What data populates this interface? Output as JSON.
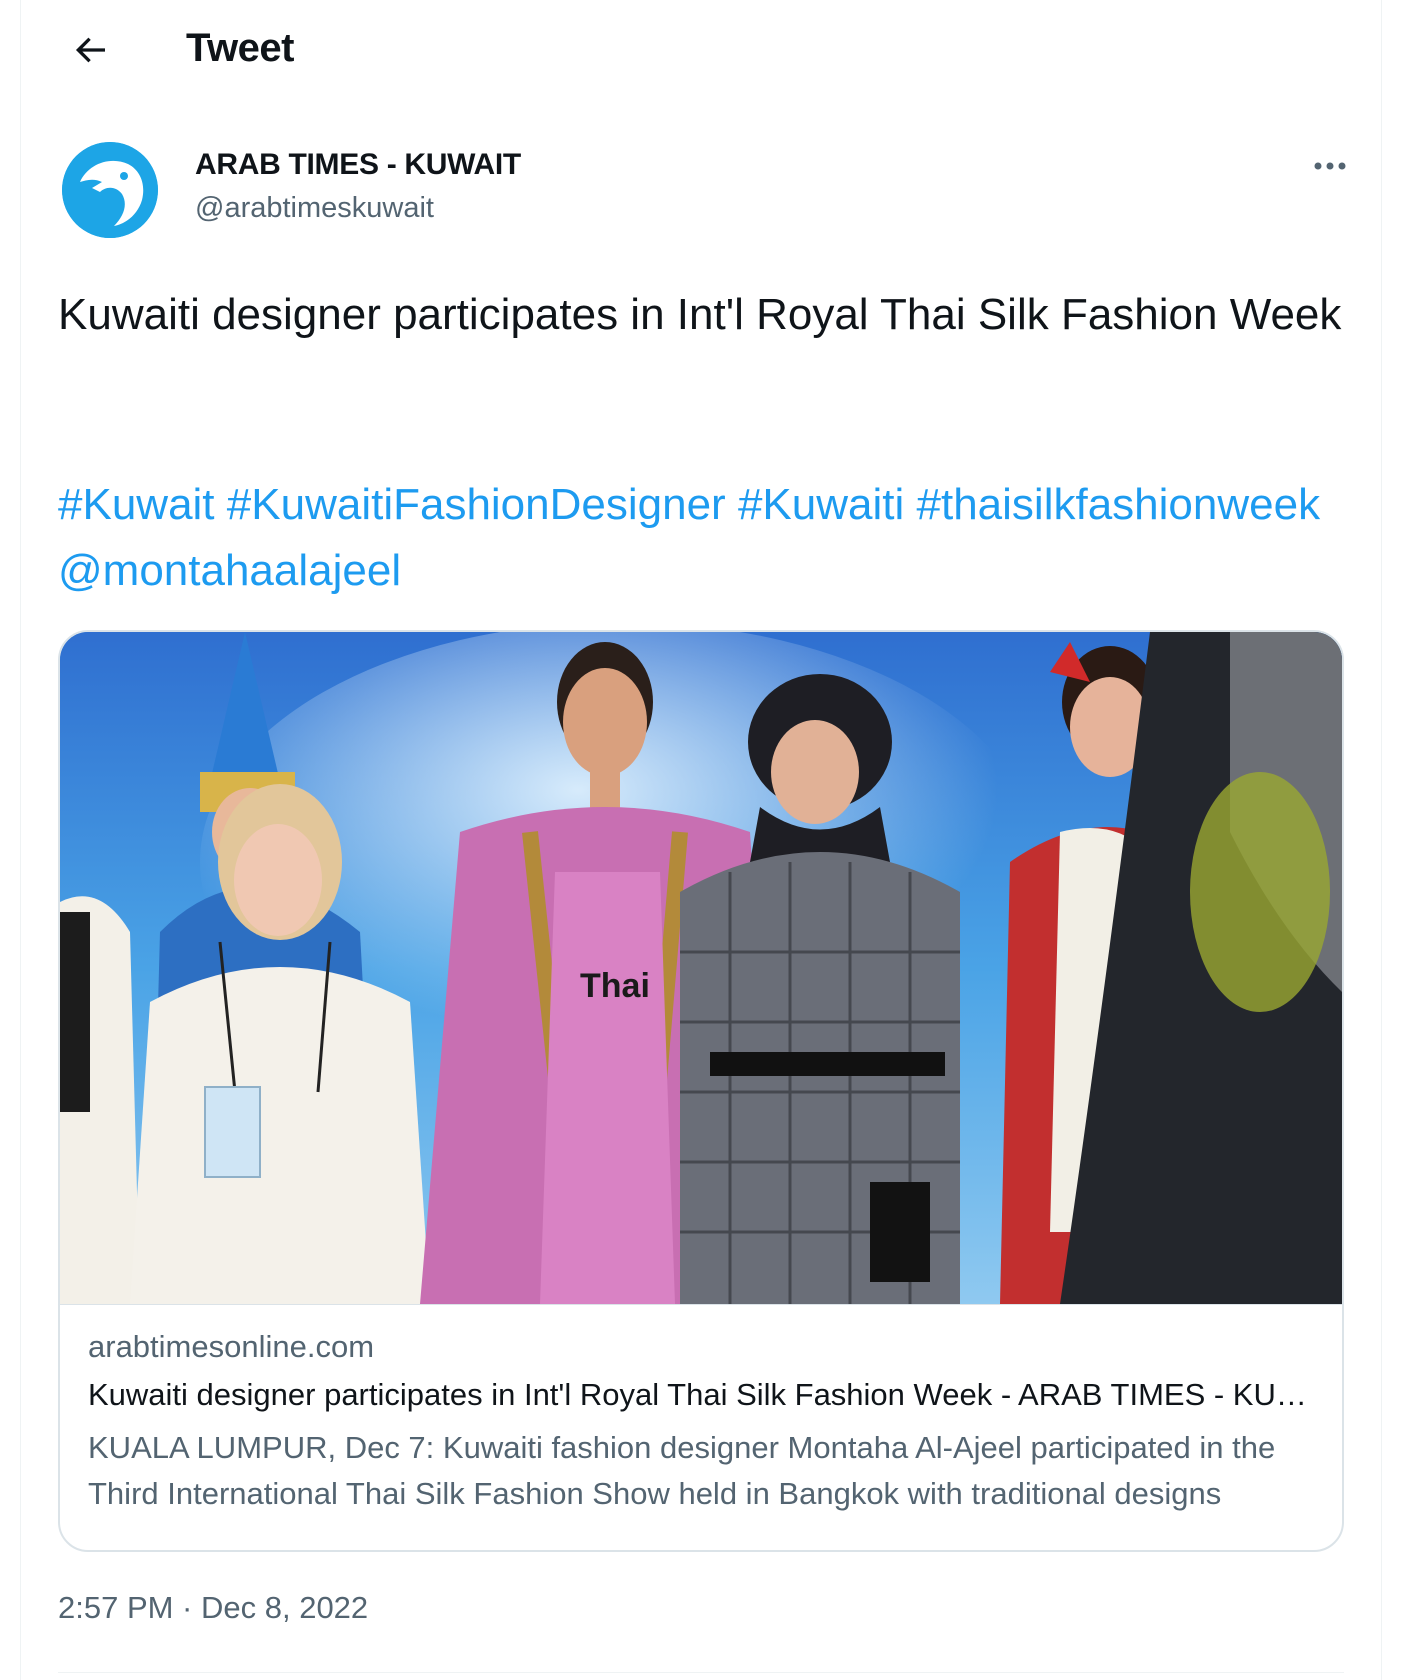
{
  "header": {
    "back_icon": "arrow-left-icon",
    "title": "Tweet"
  },
  "author": {
    "name": "ARAB TIMES - KUWAIT",
    "handle": "@arabtimeskuwait",
    "avatar_icon": "eagle-logo",
    "avatar_color": "#1da5e6",
    "more_icon": "more-dots-icon"
  },
  "tweet": {
    "text": "Kuwaiti designer participates in Int'l Royal Thai Silk Fashion Week",
    "tags": [
      "#Kuwait",
      "#KuwaitiFashionDesigner",
      "#Kuwaiti",
      "#thaisilkfashionweek",
      "@montahaalajeel"
    ],
    "link_color": "#1d9bf0"
  },
  "card": {
    "image_label": "Thai",
    "domain": "arabtimesonline.com",
    "title": "Kuwaiti designer participates in Int'l Royal Thai Silk Fashion Week - ARAB TIMES - KUWAIT NEWS",
    "description": "KUALA LUMPUR, Dec 7: Kuwaiti fashion designer Montaha Al-Ajeel participated in the Third International Thai Silk Fashion Show held in Bangkok with traditional designs"
  },
  "meta": {
    "timestamp": "2:57 PM · Dec 8, 2022"
  }
}
